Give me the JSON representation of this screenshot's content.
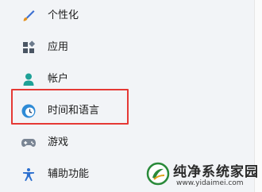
{
  "nav": {
    "items": [
      {
        "label": "个性化",
        "icon": "paint-brush-icon"
      },
      {
        "label": "应用",
        "icon": "apps-icon"
      },
      {
        "label": "帐户",
        "icon": "person-icon"
      },
      {
        "label": "时间和语言",
        "icon": "clock-globe-icon",
        "selected": true
      },
      {
        "label": "游戏",
        "icon": "gamepad-icon"
      },
      {
        "label": "辅助功能",
        "icon": "accessibility-icon"
      }
    ]
  },
  "watermark": {
    "title": "纯净系统家园",
    "url": "www.yidaimei.com"
  },
  "colors": {
    "highlight": "#e53935",
    "accent": "#0078d4"
  }
}
